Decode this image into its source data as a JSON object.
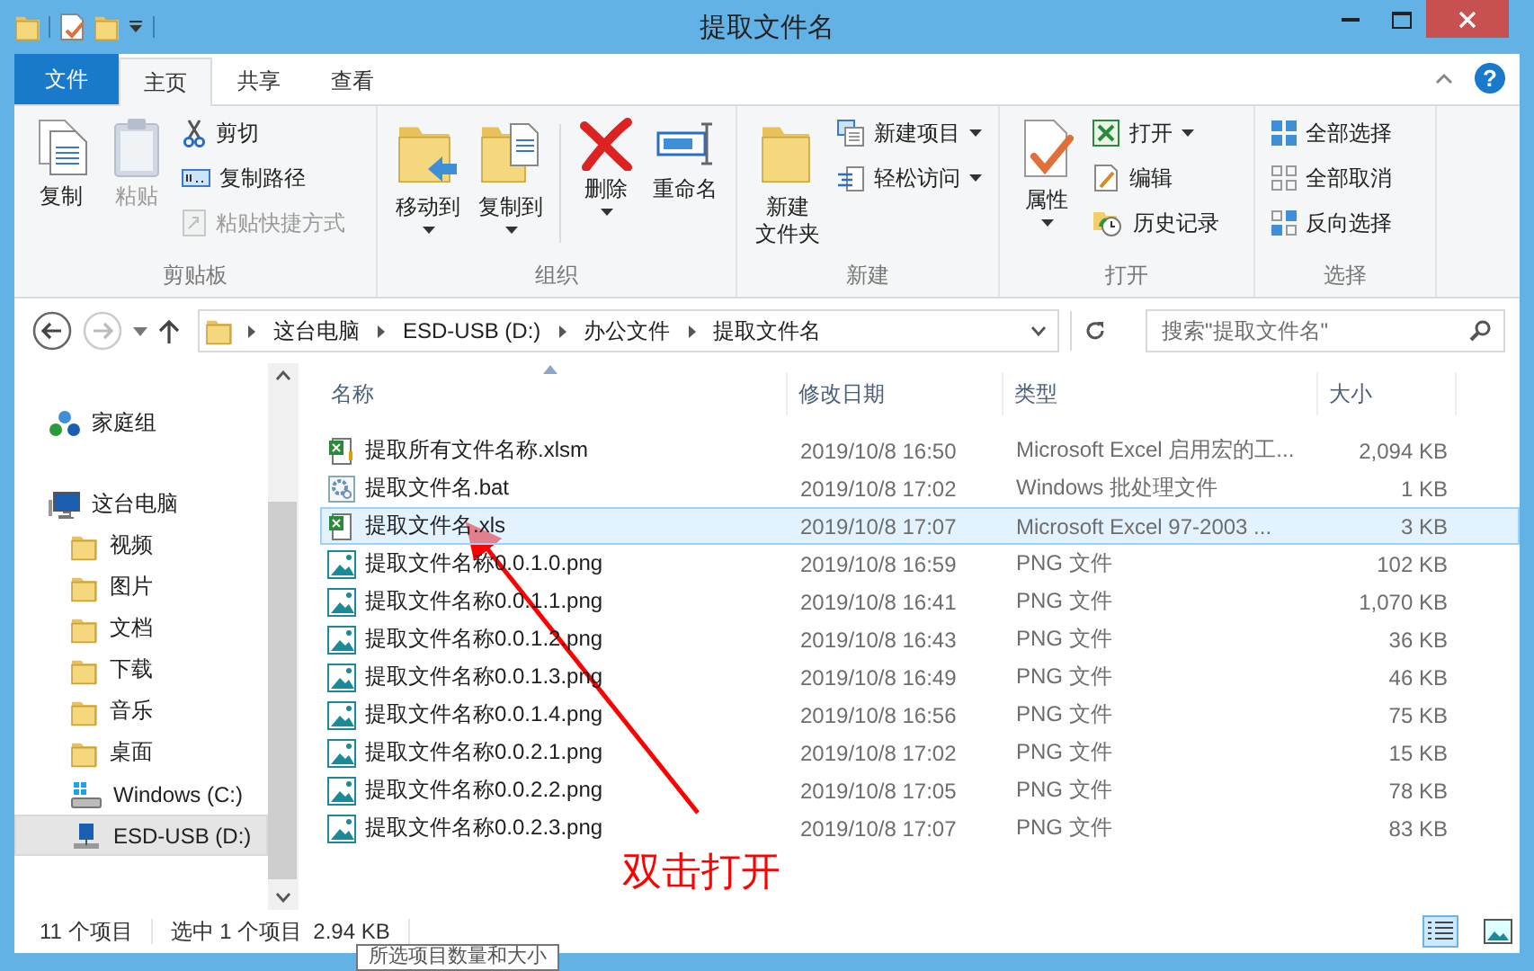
{
  "window": {
    "title": "提取文件名"
  },
  "tabs": [
    {
      "label": "文件",
      "kind": "menu",
      "selected": false
    },
    {
      "label": "主页",
      "kind": "tab",
      "selected": true
    },
    {
      "label": "共享",
      "kind": "tab",
      "selected": false
    },
    {
      "label": "查看",
      "kind": "tab",
      "selected": false
    }
  ],
  "help": {
    "label": "?"
  },
  "ribbon_groups": [
    {
      "name": "剪贴板",
      "items": [
        {
          "lines": [
            "复制"
          ],
          "kind": "large",
          "disabled": false
        },
        {
          "lines": [
            "粘贴"
          ],
          "kind": "large",
          "disabled": true
        },
        {
          "lines": [
            "剪切"
          ],
          "kind": "small",
          "disabled": false
        },
        {
          "lines": [
            "复制路径"
          ],
          "kind": "small",
          "disabled": false
        },
        {
          "lines": [
            "粘贴快捷方式"
          ],
          "kind": "small",
          "disabled": true
        }
      ]
    },
    {
      "name": "组织",
      "items": [
        {
          "lines": [
            "移动到"
          ],
          "kind": "large",
          "dropdown": true,
          "disabled": false
        },
        {
          "lines": [
            "复制到"
          ],
          "kind": "large",
          "dropdown": true,
          "disabled": false
        },
        {
          "kind": "divider"
        },
        {
          "lines": [
            "删除"
          ],
          "kind": "large",
          "dropdown": true,
          "disabled": false
        },
        {
          "lines": [
            "重命名"
          ],
          "kind": "large",
          "disabled": false
        }
      ]
    },
    {
      "name": "新建",
      "items": [
        {
          "lines": [
            "新建",
            "文件夹"
          ],
          "kind": "large",
          "disabled": false
        },
        {
          "lines": [
            "新建项目"
          ],
          "kind": "small",
          "dropdown": true,
          "disabled": false
        },
        {
          "lines": [
            "轻松访问"
          ],
          "kind": "small",
          "dropdown": true,
          "disabled": false
        }
      ]
    },
    {
      "name": "打开",
      "items": [
        {
          "lines": [
            "属性"
          ],
          "kind": "large",
          "dropdown": true,
          "disabled": false
        },
        {
          "lines": [
            "打开"
          ],
          "kind": "small",
          "dropdown": true,
          "disabled": false
        },
        {
          "lines": [
            "编辑"
          ],
          "kind": "small",
          "disabled": false
        },
        {
          "lines": [
            "历史记录"
          ],
          "kind": "small",
          "disabled": false
        }
      ]
    },
    {
      "name": "选择",
      "items": [
        {
          "lines": [
            "全部选择"
          ],
          "kind": "small",
          "disabled": false
        },
        {
          "lines": [
            "全部取消"
          ],
          "kind": "small",
          "disabled": false
        },
        {
          "lines": [
            "反向选择"
          ],
          "kind": "small",
          "disabled": false
        }
      ]
    }
  ],
  "address": {
    "breadcrumbs": [
      "这台电脑",
      "ESD-USB (D:)",
      "办公文件",
      "提取文件名"
    ]
  },
  "search": {
    "placeholder": "搜索\"提取文件名\""
  },
  "nav": [
    {
      "label": "家庭组",
      "kind": "homegroup",
      "selected": false
    },
    {
      "label": "这台电脑",
      "kind": "computer",
      "selected": false,
      "children": [
        {
          "label": "视频",
          "kind": "folder",
          "selected": false
        },
        {
          "label": "图片",
          "kind": "folder",
          "selected": false
        },
        {
          "label": "文档",
          "kind": "folder",
          "selected": false
        },
        {
          "label": "下载",
          "kind": "folder",
          "selected": false
        },
        {
          "label": "音乐",
          "kind": "folder",
          "selected": false
        },
        {
          "label": "桌面",
          "kind": "folder",
          "selected": false
        },
        {
          "label": "Windows (C:)",
          "kind": "drive",
          "selected": false
        },
        {
          "label": "ESD-USB (D:)",
          "kind": "usb",
          "selected": true
        }
      ]
    }
  ],
  "table": {
    "columns": [
      "名称",
      "修改日期",
      "类型",
      "大小"
    ],
    "rows": [
      {
        "kind": "xlsm",
        "name": "提取所有文件名称.xlsm",
        "date": "2019/10/8 16:50",
        "type": "Microsoft Excel 启用宏的工...",
        "size": "2,094 KB",
        "selected": false
      },
      {
        "kind": "bat",
        "name": "提取文件名.bat",
        "date": "2019/10/8 17:02",
        "type": "Windows 批处理文件",
        "size": "1 KB",
        "selected": false
      },
      {
        "kind": "xls",
        "name": "提取文件名.xls",
        "date": "2019/10/8 17:07",
        "type": "Microsoft Excel 97-2003 ...",
        "size": "3 KB",
        "selected": true
      },
      {
        "kind": "png",
        "name": "提取文件名称0.0.1.0.png",
        "date": "2019/10/8 16:59",
        "type": "PNG 文件",
        "size": "102 KB",
        "selected": false
      },
      {
        "kind": "png",
        "name": "提取文件名称0.0.1.1.png",
        "date": "2019/10/8 16:41",
        "type": "PNG 文件",
        "size": "1,070 KB",
        "selected": false
      },
      {
        "kind": "png",
        "name": "提取文件名称0.0.1.2.png",
        "date": "2019/10/8 16:43",
        "type": "PNG 文件",
        "size": "36 KB",
        "selected": false
      },
      {
        "kind": "png",
        "name": "提取文件名称0.0.1.3.png",
        "date": "2019/10/8 16:49",
        "type": "PNG 文件",
        "size": "46 KB",
        "selected": false
      },
      {
        "kind": "png",
        "name": "提取文件名称0.0.1.4.png",
        "date": "2019/10/8 16:56",
        "type": "PNG 文件",
        "size": "75 KB",
        "selected": false
      },
      {
        "kind": "png",
        "name": "提取文件名称0.0.2.1.png",
        "date": "2019/10/8 17:02",
        "type": "PNG 文件",
        "size": "15 KB",
        "selected": false
      },
      {
        "kind": "png",
        "name": "提取文件名称0.0.2.2.png",
        "date": "2019/10/8 17:05",
        "type": "PNG 文件",
        "size": "78 KB",
        "selected": false
      },
      {
        "kind": "png",
        "name": "提取文件名称0.0.2.3.png",
        "date": "2019/10/8 17:07",
        "type": "PNG 文件",
        "size": "83 KB",
        "selected": false
      }
    ]
  },
  "annotation": {
    "text": "双击打开"
  },
  "status_bar": {
    "item_count": "11 个项目",
    "selection": "选中 1 个项目",
    "selection_size": "2.94 KB",
    "views": [
      {
        "kind": "details",
        "selected": true
      },
      {
        "kind": "large_icons",
        "selected": false
      }
    ]
  },
  "tooltip": {
    "text": "所选项目数量和大小"
  }
}
